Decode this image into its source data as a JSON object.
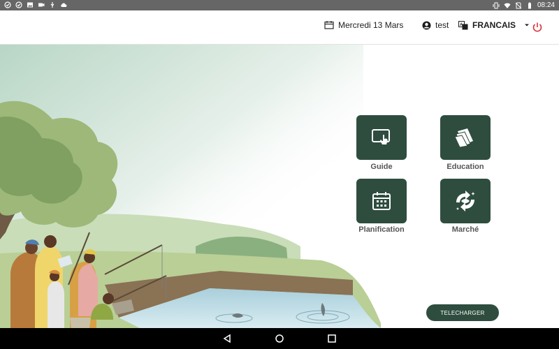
{
  "status_bar": {
    "time": "08:24",
    "left_icons": [
      "check-circle-icon",
      "check-circle-icon",
      "image-icon",
      "video-icon",
      "usb-icon",
      "cloud-icon"
    ],
    "right_icons": [
      "vibrate-icon",
      "wifi-icon",
      "no-sim-icon",
      "battery-icon"
    ]
  },
  "header": {
    "date_label": "Mercredi 13  Mars",
    "username": "test",
    "language": "FRANCAIS"
  },
  "menu": {
    "items": [
      {
        "label": "Guide",
        "icon": "touch-screen-icon"
      },
      {
        "label": "Education",
        "icon": "book-pages-icon"
      },
      {
        "label": "Planification",
        "icon": "calendar-icon"
      },
      {
        "label": "Marché",
        "icon": "fish-cycle-icon"
      }
    ]
  },
  "download_label": "TELECHARGER",
  "colors": {
    "tile": "#2e4d3f",
    "accent_power": "#d9343b",
    "status_bar": "#666666",
    "nav_bar": "#000000"
  }
}
